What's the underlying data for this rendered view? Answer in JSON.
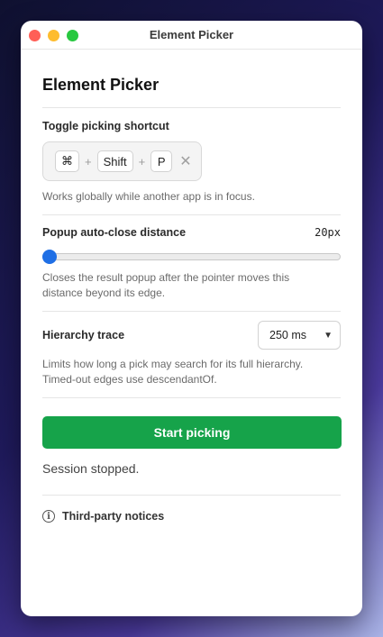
{
  "window": {
    "title": "Element Picker"
  },
  "page": {
    "title": "Element Picker"
  },
  "shortcut": {
    "label": "Toggle picking shortcut",
    "keys": [
      "⌘",
      "Shift",
      "P"
    ],
    "plus": "+",
    "clear_glyph": "✕",
    "help": "Works globally while another app is in focus."
  },
  "popup": {
    "label": "Popup auto-close distance",
    "value_text": "20px",
    "value": 20,
    "slider_fraction": 0.0,
    "help": "Closes the result popup after the pointer moves this distance beyond its edge."
  },
  "trace": {
    "label": "Hierarchy trace",
    "selected": "250 ms",
    "help": "Limits how long a pick may search for its full hierarchy. Timed-out edges use descendantOf."
  },
  "actions": {
    "start_label": "Start picking"
  },
  "status": {
    "text": "Session stopped."
  },
  "footer": {
    "notices_label": "Third-party notices",
    "info_glyph": "i"
  },
  "colors": {
    "accent_green": "#16a34a",
    "slider_blue": "#1f6fe5"
  }
}
